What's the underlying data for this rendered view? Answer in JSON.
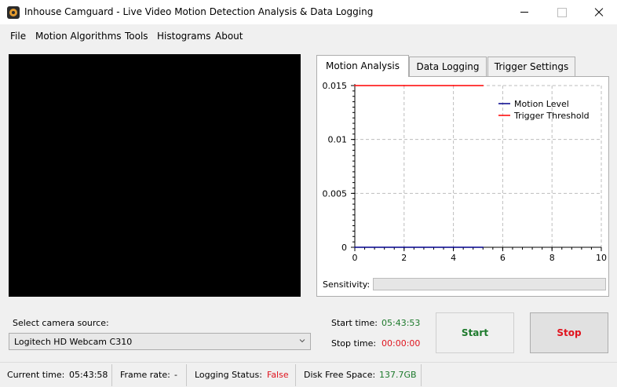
{
  "window": {
    "title": "Inhouse Camguard - Live Video Motion Detection Analysis & Data Logging"
  },
  "menu": {
    "items": [
      "File",
      "Motion Algorithms",
      "Tools",
      "Histograms",
      "About"
    ]
  },
  "tabs": {
    "items": [
      "Motion Analysis",
      "Data Logging",
      "Trigger Settings"
    ],
    "active": "Motion Analysis"
  },
  "chart_data": {
    "type": "line",
    "title": "",
    "xlabel": "",
    "ylabel": "",
    "xlim": [
      0,
      10
    ],
    "ylim": [
      0,
      0.015
    ],
    "x_ticks": [
      0,
      2,
      4,
      6,
      8,
      10
    ],
    "y_ticks": [
      0,
      0.005,
      0.01,
      0.015
    ],
    "y_tick_labels": [
      "0",
      "0.005",
      "0.01",
      "0.015"
    ],
    "grid": true,
    "legend_position": "top-right",
    "series": [
      {
        "name": "Motion Level",
        "color": "#00008b",
        "x": [
          0,
          2,
          4,
          5.2
        ],
        "y": [
          0,
          0,
          0,
          0
        ]
      },
      {
        "name": "Trigger Threshold",
        "color": "#ff0000",
        "x": [
          0,
          2,
          4,
          5.2
        ],
        "y": [
          0.015,
          0.015,
          0.015,
          0.015
        ]
      }
    ]
  },
  "sensitivity": {
    "label": "Sensitivity:"
  },
  "camera": {
    "label": "Select camera source:",
    "selected": "Logitech HD Webcam C310"
  },
  "times": {
    "start_label": "Start time:",
    "start_value": "05:43:53",
    "stop_label": "Stop time:",
    "stop_value": "00:00:00"
  },
  "buttons": {
    "start": "Start",
    "stop": "Stop"
  },
  "status": {
    "current_time_label": "Current time:",
    "current_time_value": "05:43:58",
    "frame_rate_label": "Frame rate:",
    "frame_rate_value": "-",
    "logging_label": "Logging Status:",
    "logging_value": "False",
    "disk_label": "Disk Free Space:",
    "disk_value": "137.7GB"
  },
  "colors": {
    "start_time": "#1d7a2c",
    "stop_time": "#e0141e",
    "logging_false": "#e0141e",
    "disk_value": "#1d7a2c"
  }
}
